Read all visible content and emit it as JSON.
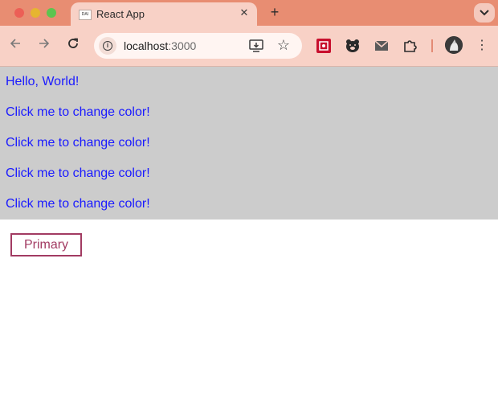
{
  "browser": {
    "tab": {
      "title": "React App",
      "favicon_label": "DAI",
      "close_icon": "close-icon"
    },
    "new_tab_icon": "plus-icon",
    "tab_search_icon": "chevron-down-icon",
    "toolbar": {
      "back_icon": "arrow-left-icon",
      "forward_icon": "arrow-right-icon",
      "reload_icon": "reload-icon",
      "url_host": "localhost",
      "url_port": ":3000",
      "extensions": [
        "red-extension-icon",
        "bear-extension-icon",
        "mail-extension-icon",
        "puzzle-extension-icon"
      ]
    }
  },
  "page": {
    "lines": [
      "Hello, World!",
      "Click me to change color!",
      "Click me to change color!",
      "Click me to change color!",
      "Click me to change color!"
    ],
    "button_label": "Primary"
  },
  "colors": {
    "text": "#1a1aff",
    "block_bg": "#cccccc",
    "button_border": "#a23b62",
    "tabstrip": "#e88d72",
    "toolbar": "#f8d1c6"
  }
}
